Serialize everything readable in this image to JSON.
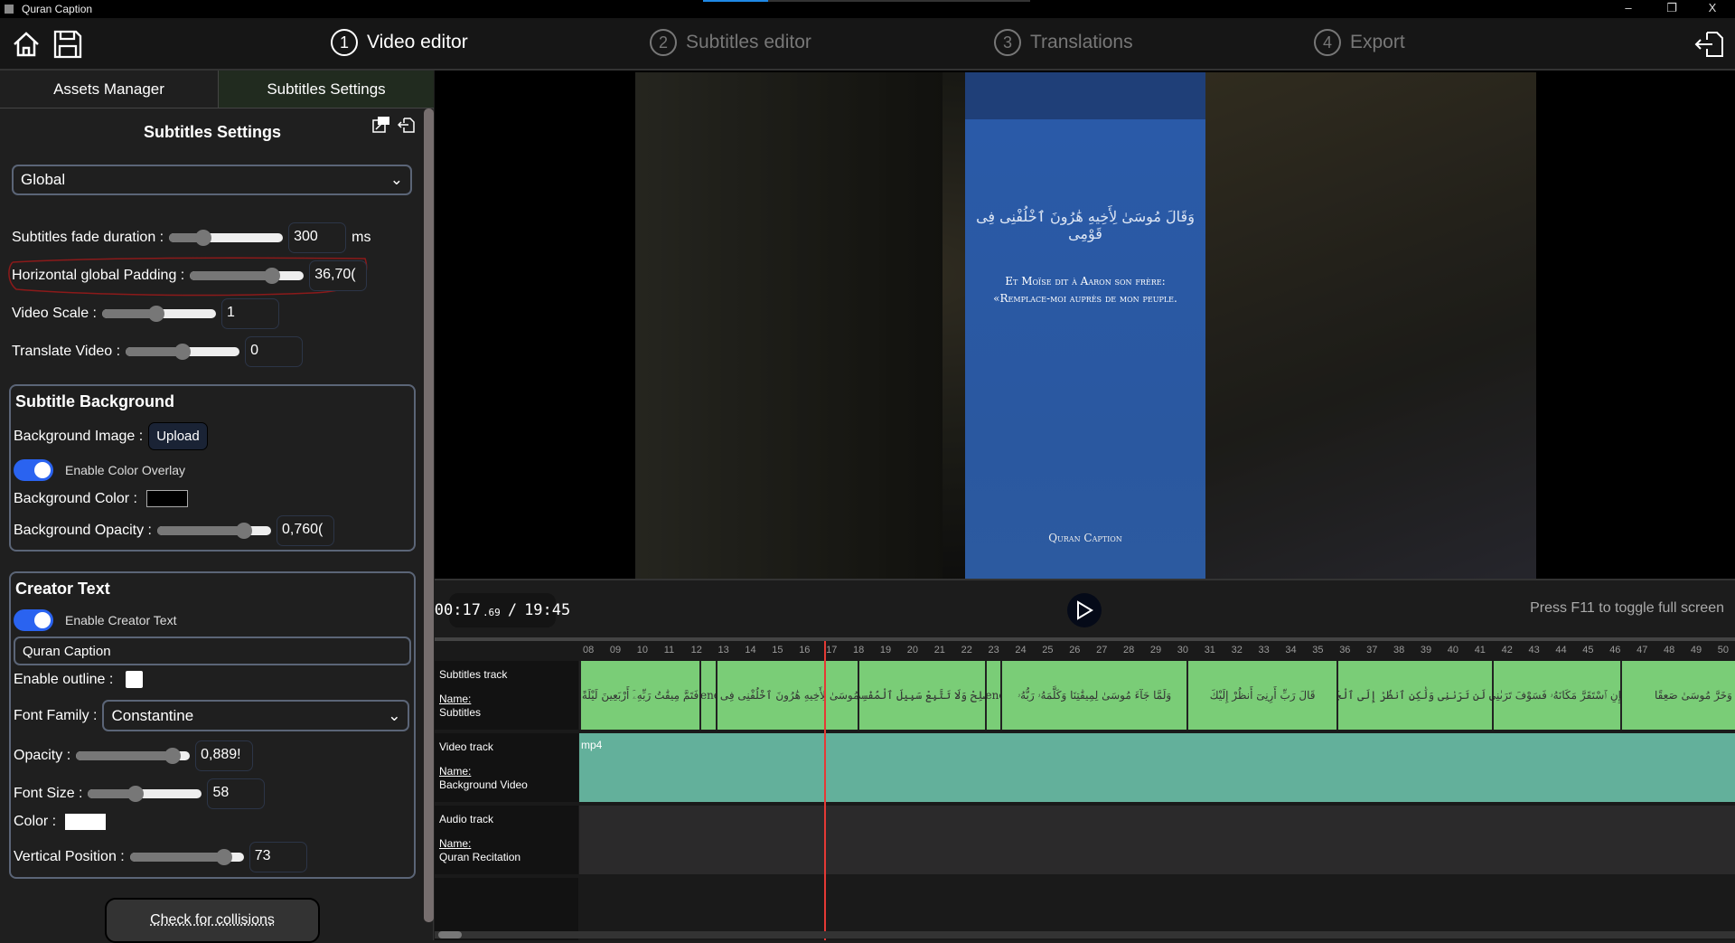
{
  "window": {
    "title": "Quran Caption",
    "minimize": "–",
    "maximize": "❐",
    "close": "X"
  },
  "header": {
    "steps": [
      {
        "n": "1",
        "label": "Video editor",
        "active": true
      },
      {
        "n": "2",
        "label": "Subtitles editor",
        "active": false
      },
      {
        "n": "3",
        "label": "Translations",
        "active": false
      },
      {
        "n": "4",
        "label": "Export",
        "active": false
      }
    ]
  },
  "left": {
    "tabs": [
      "Assets Manager",
      "Subtitles Settings"
    ],
    "title": "Subtitles Settings",
    "scope": "Global",
    "fade": {
      "label": "Subtitles fade duration :",
      "value": "300",
      "unit": "ms",
      "fraction": 0.3
    },
    "padding": {
      "label": "Horizontal global Padding :",
      "value": "36,70(",
      "fraction": 0.72
    },
    "scale": {
      "label": "Video Scale :",
      "value": "1",
      "fraction": 0.48
    },
    "translate": {
      "label": "Translate Video :",
      "value": "0",
      "fraction": 0.5
    },
    "bg": {
      "title": "Subtitle Background",
      "image_label": "Background Image :",
      "upload": "Upload",
      "overlay": "Enable Color Overlay",
      "color_label": "Background Color :",
      "color": "#000000",
      "opacity_label": "Background Opacity :",
      "opacity": "0,760(",
      "opacity_fraction": 0.76
    },
    "creator": {
      "title": "Creator Text",
      "enable": "Enable Creator Text",
      "text": "Quran Caption",
      "outline_label": "Enable outline :",
      "font_label": "Font Family :",
      "font": "Constantine",
      "opacity_label": "Opacity :",
      "opacity": "0,889!",
      "opacity_fraction": 0.85,
      "size_label": "Font Size :",
      "size": "58",
      "size_fraction": 0.42,
      "color_label": "Color :",
      "color": "#ffffff",
      "vpos_label": "Vertical Position :",
      "vpos": "73",
      "vpos_fraction": 0.83
    },
    "collisions": "Check for collisions"
  },
  "preview": {
    "arabic": "وَقَالَ مُوسَىٰ لِأَخِيهِ هَٰرُونَ ٱخْلُفْنِى فِى قَوْمِى",
    "translation_1": "Et Moïse dit à Aaron son frère:",
    "translation_2": "«Remplace-moi auprès de mon peuple.",
    "creator": "Quran Caption",
    "overlay_color": "#2a5aa8"
  },
  "controls": {
    "time": "00:17",
    "ms": ".69",
    "sep": "/",
    "duration": "19:45",
    "hint": "Press F11 to toggle full screen"
  },
  "timeline": {
    "current_time": 17.69,
    "ticks": [
      "08",
      "09",
      "10",
      "11",
      "12",
      "13",
      "14",
      "15",
      "16",
      "17",
      "18",
      "19",
      "20",
      "21",
      "22",
      "23",
      "24",
      "25",
      "26",
      "27",
      "28",
      "29",
      "30",
      "31",
      "32",
      "33",
      "34",
      "35",
      "36",
      "37",
      "38",
      "39",
      "40",
      "41",
      "42",
      "43",
      "44",
      "45",
      "46",
      "47",
      "48",
      "49",
      "50"
    ],
    "tracks": [
      {
        "title": "Subtitles track",
        "name_label": "Name:",
        "name": "Subtitles"
      },
      {
        "title": "Video track",
        "name_label": "Name:",
        "name": "Background Video",
        "clip": "mp4"
      },
      {
        "title": "Audio track",
        "name_label": "Name:",
        "name": "Quran Recitation"
      }
    ],
    "segments": [
      {
        "start": 8.63,
        "end": 13.08,
        "text": "فَتَمَّ مِيقَٰتُ رَبِّهِۦٓ أَرْبَعِينَ لَيْلَةً"
      },
      {
        "start": 13.08,
        "end": 13.68,
        "text": "lene"
      },
      {
        "start": 13.68,
        "end": 18.93,
        "text": "وَقَالَ مُوسَىٰ لِأَخِيهِ هَٰرُونَ ٱخْلُفْنِى فِى قَوْمِى"
      },
      {
        "start": 18.93,
        "end": 23.65,
        "text": "وَأَصْلِحْ وَلَا تَتَّبِعْ سَبِيلَ ٱلْمُفْسِدِينَ"
      },
      {
        "start": 23.65,
        "end": 24.22,
        "text": "lene"
      },
      {
        "start": 24.22,
        "end": 31.11,
        "text": "وَلَمَّا جَآءَ مُوسَىٰ لِمِيقَٰتِنَا وَكَلَّمَهُۥ رَبُّهُۥ"
      },
      {
        "start": 31.11,
        "end": 36.66,
        "text": "قَالَ رَبِّ أَرِنِىٓ أَنظُرْ إِلَيْكَ"
      },
      {
        "start": 36.66,
        "end": 42.41,
        "text": "قَالَ لَن تَرَىٰنِى وَلَٰكِنِ ٱنظُرْ إِلَى ٱلْجَبَلِ"
      },
      {
        "start": 42.41,
        "end": 47.16,
        "text": "فَإِنِ ٱسْتَقَرَّ مَكَانَهُۥ فَسَوْفَ تَرَىٰنِى"
      },
      {
        "start": 47.16,
        "end": 52.5,
        "text": "وَخَرَّ مُوسَىٰ صَعِقًا"
      }
    ],
    "subtitle_color": "#7acd77",
    "video_color": "#63b09b",
    "playhead_color": "#e53935"
  }
}
